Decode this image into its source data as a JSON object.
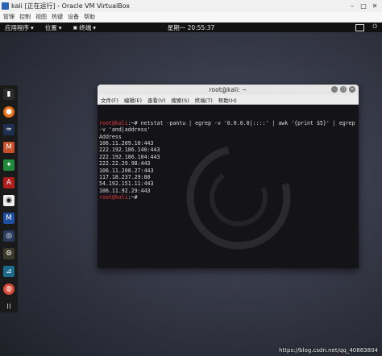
{
  "window": {
    "title": "kali [正在运行] - Oracle VM VirtualBox"
  },
  "vbox_menu": [
    "管理",
    "控制",
    "视图",
    "热键",
    "设备",
    "帮助"
  ],
  "topbar": {
    "apps": "应用程序",
    "places": "位置",
    "terminal": "终端",
    "clock": "星期一 20:55:37"
  },
  "terminal": {
    "title": "root@kali: ~",
    "menu": [
      "文件(F)",
      "编辑(E)",
      "查看(V)",
      "搜索(S)",
      "终端(T)",
      "帮助(H)"
    ],
    "prompt": "root@kali",
    "prompt_suffix": ":~# ",
    "command": "netstat -pantu | egrep -v '0.0.0.0|::::' | awk '{print $5}' | egrep -v 'and|address'",
    "output": [
      "Address",
      "106.11.209.10:443",
      "222.192.186.140:443",
      "222.192.186.104:443",
      "222.22.29.98:443",
      "106.11.208.27:443",
      "117.18.237.29:80",
      "54.192.151.11:443",
      "106.11.92.29:443"
    ],
    "prompt2_suffix": ":~# "
  },
  "watermark": "https://blog.csdn.net/qq_40883804",
  "colors": {
    "prompt": "#e03a3a",
    "topbar": "#111111"
  }
}
